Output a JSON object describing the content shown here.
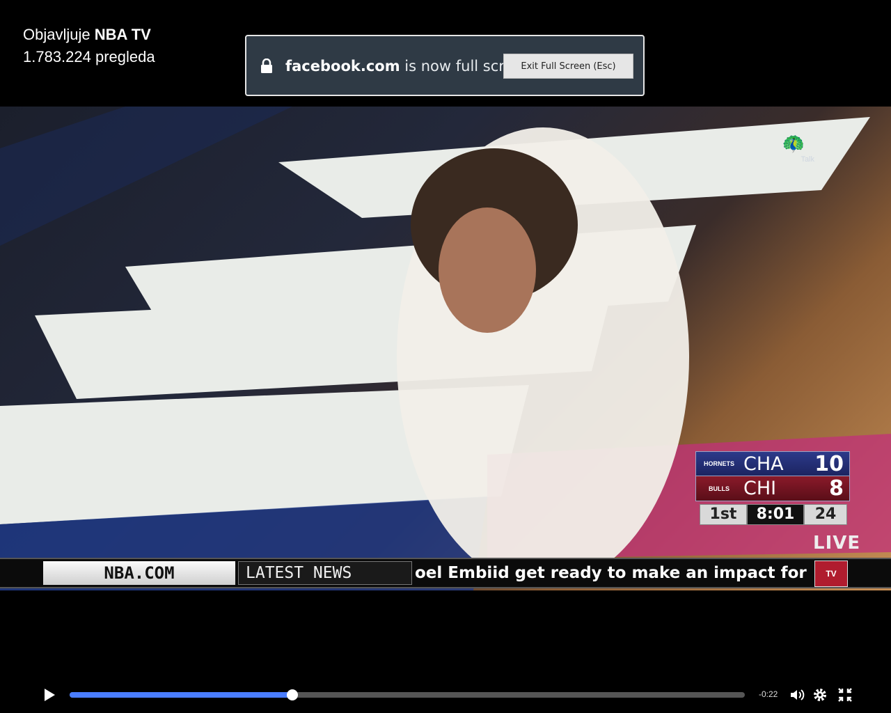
{
  "publisher": {
    "prefix": "Objavljuje",
    "name": "NBA TV",
    "views": "1.783.224 pregleda"
  },
  "fullscreen_notice": {
    "domain": "facebook.com",
    "message": "is now full screen",
    "exit_button": "Exit Full Screen (Esc)"
  },
  "video": {
    "network_logo_caption": "Talk",
    "live_label": "LIVE",
    "scoreboard": {
      "teams": [
        {
          "logo_text": "HORNETS",
          "abbr": "CHA",
          "score": "10",
          "color": "#2c3a8a"
        },
        {
          "logo_text": "BULLS",
          "abbr": "CHI",
          "score": "8",
          "color": "#8a1a2a"
        }
      ],
      "period": "1st",
      "clock": "8:01",
      "shot_clock": "24"
    },
    "ticker": {
      "brand": "NBA.COM",
      "section": "LATEST NEWS",
      "headline": "oel Embiid get ready to make an impact for the S",
      "logo": "TV"
    }
  },
  "player": {
    "progress": 0.33,
    "remaining": "-0:22",
    "accent": "#4a7dff",
    "icons": [
      "play-icon",
      "volume-icon",
      "settings-icon",
      "exit-fullscreen-icon"
    ]
  }
}
